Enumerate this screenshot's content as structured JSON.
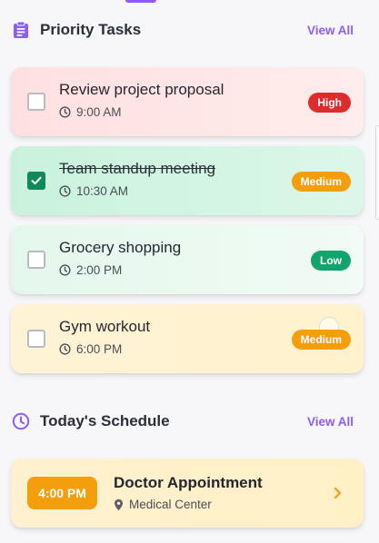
{
  "priority": {
    "title": "Priority Tasks",
    "view_all": "View All",
    "tasks": [
      {
        "title": "Review project proposal",
        "time": "9:00 AM",
        "priority": "High",
        "completed": false
      },
      {
        "title": "Team standup meeting",
        "time": "10:30 AM",
        "priority": "Medium",
        "completed": true
      },
      {
        "title": "Grocery shopping",
        "time": "2:00 PM",
        "priority": "Low",
        "completed": false
      },
      {
        "title": "Gym workout",
        "time": "6:00 PM",
        "priority": "Medium",
        "completed": false
      }
    ]
  },
  "schedule": {
    "title": "Today's Schedule",
    "view_all": "View All",
    "events": [
      {
        "time": "4:00 PM",
        "title": "Doctor Appointment",
        "location": "Medical Center"
      }
    ]
  },
  "icons": {
    "priority_header": "clipboard-icon",
    "schedule_header": "clock-icon",
    "time": "clock-icon",
    "location": "map-pin-icon",
    "chevron": "chevron-right-icon"
  },
  "colors": {
    "accent": "#8b5cf6",
    "high": "#dc2c2c",
    "medium": "#f59e0b",
    "low": "#12a46c",
    "checked": "#118a5a"
  }
}
